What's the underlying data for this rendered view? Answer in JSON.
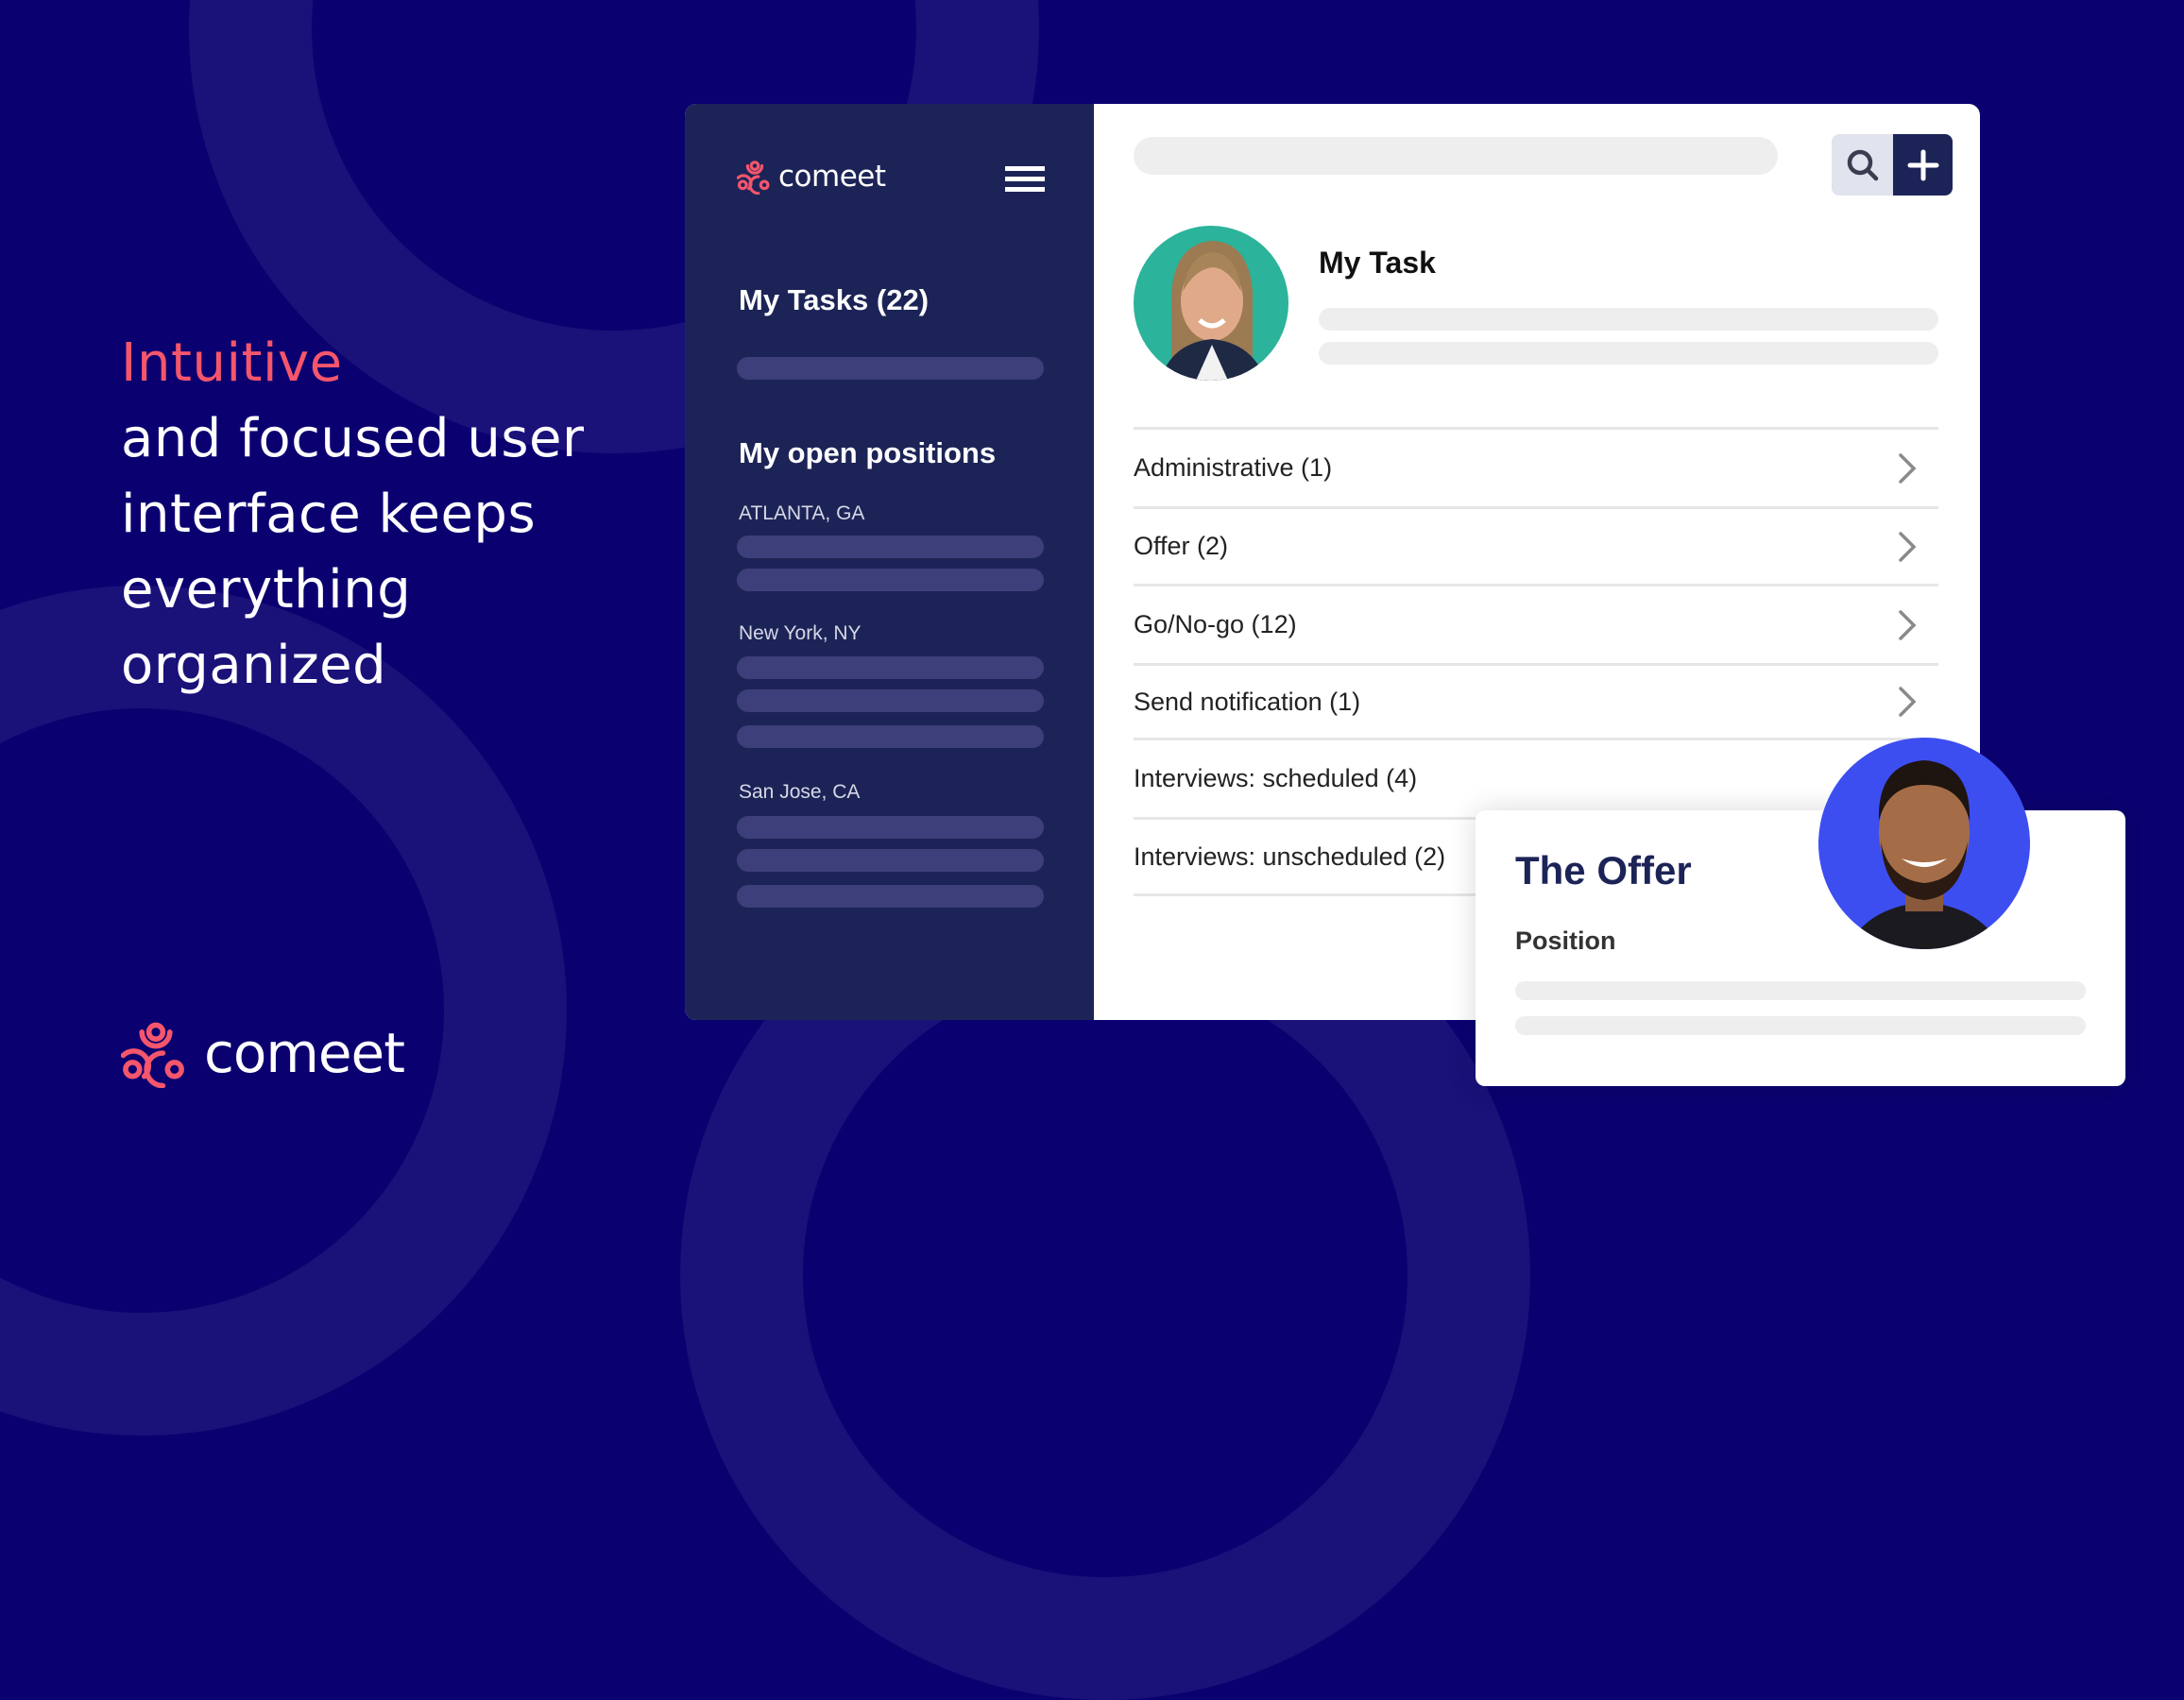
{
  "hero": {
    "accent": "Intuitive",
    "lines": [
      "and focused user",
      "interface keeps",
      "everything",
      "organized"
    ]
  },
  "brand": {
    "name": "comeet",
    "accent_color": "#f5566b"
  },
  "sidebar": {
    "logo": "comeet",
    "menu_icon": "hamburger-icon",
    "tasks_heading": "My Tasks (22)",
    "positions_heading": "My open positions",
    "locations": [
      {
        "name": "ATLANTA, GA",
        "placeholder_rows": 2
      },
      {
        "name": "New York, NY",
        "placeholder_rows": 3
      },
      {
        "name": "San Jose, CA",
        "placeholder_rows": 3
      }
    ]
  },
  "main": {
    "search_icon": "search-icon",
    "add_icon": "plus-icon",
    "task_title": "My Task",
    "task_rows": [
      {
        "label": "Administrative (1)",
        "chevron": true
      },
      {
        "label": "Offer (2)",
        "chevron": true
      },
      {
        "label": "Go/No-go (12)",
        "chevron": true
      },
      {
        "label": "Send notification (1)",
        "chevron": true
      },
      {
        "label": "Interviews: scheduled (4)",
        "chevron": false
      },
      {
        "label": "Interviews: unscheduled (2)",
        "chevron": false
      }
    ]
  },
  "offer_card": {
    "title": "The Offer",
    "label": "Position"
  },
  "colors": {
    "background": "#0b0070",
    "sidebar": "#1c2457",
    "accent": "#f5566b",
    "avatar1_bg": "#2bb39b",
    "avatar2_bg": "#3d4ef0"
  }
}
